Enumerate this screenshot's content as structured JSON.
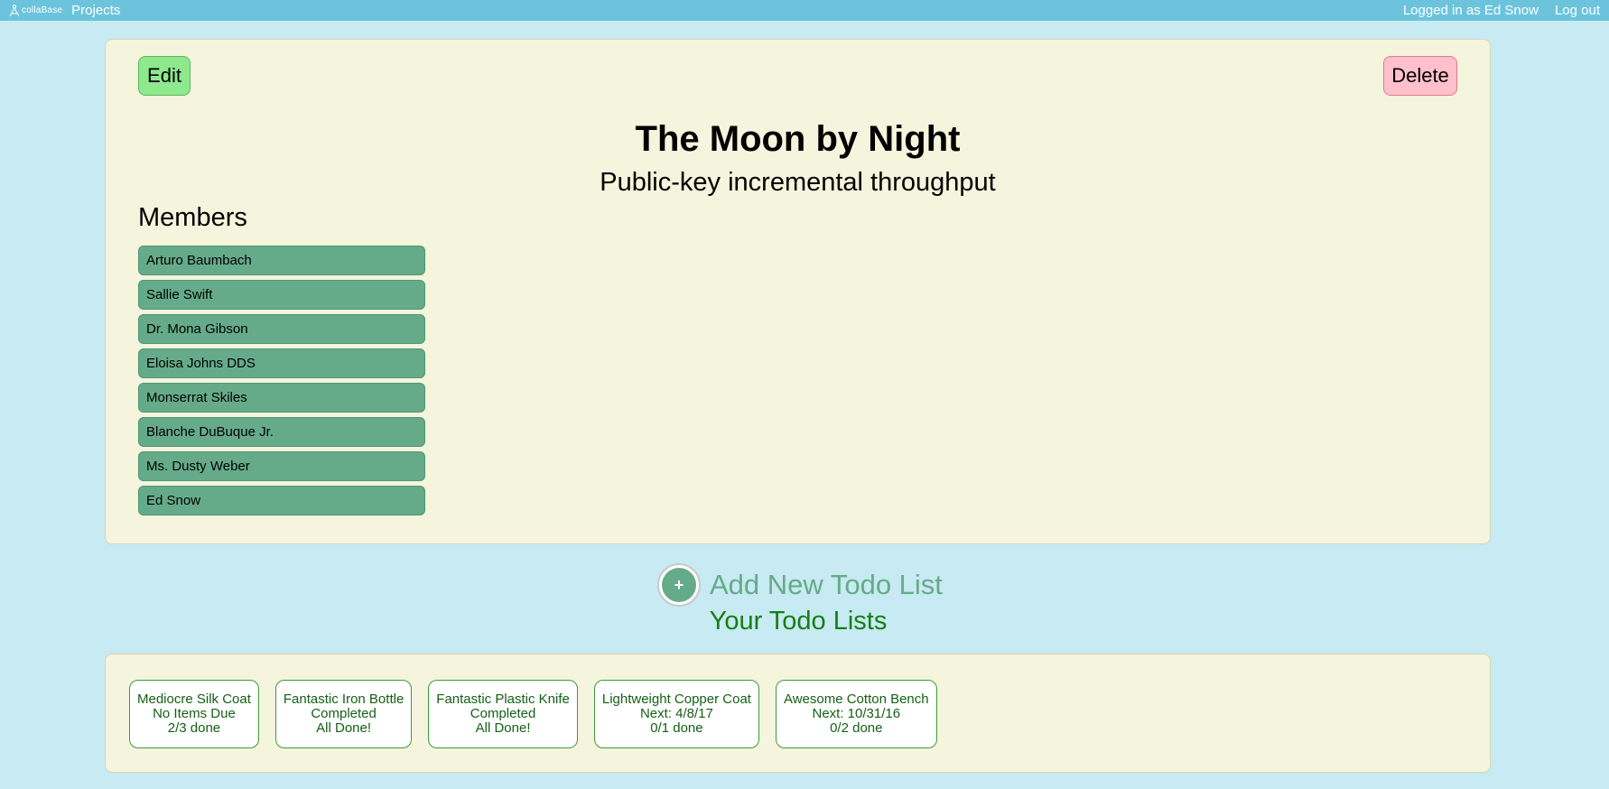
{
  "nav": {
    "brand": "collaBase",
    "projects": "Projects",
    "logged_in": "Logged in as Ed Snow",
    "logout": "Log out"
  },
  "project": {
    "edit_label": "Edit",
    "delete_label": "Delete",
    "title": "The Moon by Night",
    "subtitle": "Public-key incremental throughput",
    "members_heading": "Members",
    "members": [
      "Arturo Baumbach",
      "Sallie Swift",
      "Dr. Mona Gibson",
      "Eloisa Johns DDS",
      "Monserrat Skiles",
      "Blanche DuBuque Jr.",
      "Ms. Dusty Weber",
      "Ed Snow"
    ]
  },
  "add_new": {
    "icon": "+",
    "label": "Add New Todo List"
  },
  "lists_heading": "Your Todo Lists",
  "todo_lists": [
    {
      "name": "Mediocre Silk Coat",
      "status": "No Items Due",
      "progress": "2/3 done"
    },
    {
      "name": "Fantastic Iron Bottle",
      "status": "Completed",
      "progress": "All Done!"
    },
    {
      "name": "Fantastic Plastic Knife",
      "status": "Completed",
      "progress": "All Done!"
    },
    {
      "name": "Lightweight Copper Coat",
      "status": "Next: 4/8/17",
      "progress": "0/1 done"
    },
    {
      "name": "Awesome Cotton Bench",
      "status": "Next: 10/31/16",
      "progress": "0/2 done"
    }
  ],
  "colors": {
    "background": "#c8eaf2",
    "navbar": "#6bc4dc",
    "panel": "#f5f4dc",
    "member": "#65ab8a",
    "edit": "#8ee88e",
    "delete": "#ffc0cb",
    "heading_green": "#157f15"
  }
}
